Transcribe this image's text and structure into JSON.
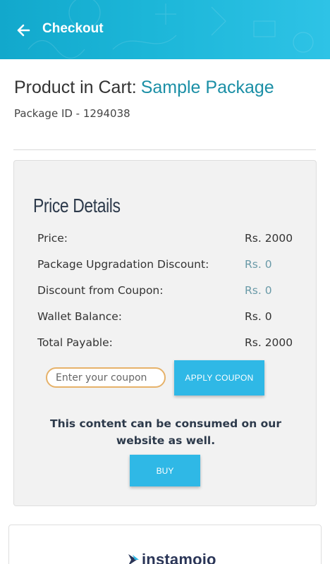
{
  "header": {
    "title": "Checkout",
    "back_icon": "arrow-left-icon",
    "background_color": "#1cb6d8"
  },
  "product": {
    "prefix": "Product in Cart:",
    "name": "Sample Package",
    "package_id": "Package ID - 1294038",
    "name_color": "#1b8fa6"
  },
  "price_details": {
    "title": "Price Details",
    "rows": [
      {
        "label": "Price:",
        "value": "Rs. 2000"
      },
      {
        "label": "Package Upgradation Discount:",
        "value": "Rs. 0"
      },
      {
        "label": "Discount from Coupon:",
        "value": "Rs. 0"
      },
      {
        "label": "Wallet Balance:",
        "value": "Rs. 0"
      },
      {
        "label": "Total Payable:",
        "value": "Rs. 2000"
      }
    ]
  },
  "coupon": {
    "placeholder": "Enter your coupon",
    "value": "",
    "apply_label": "APPLY COUPON"
  },
  "notice": "This content can be consumed on our website as well.",
  "buy_label": "BUY",
  "payment": {
    "brand": "instamojo",
    "brand_icon": "instamojo-logo-icon"
  },
  "colors": {
    "button": "#2fb8e6",
    "coupon_border": "#e6b26a"
  }
}
